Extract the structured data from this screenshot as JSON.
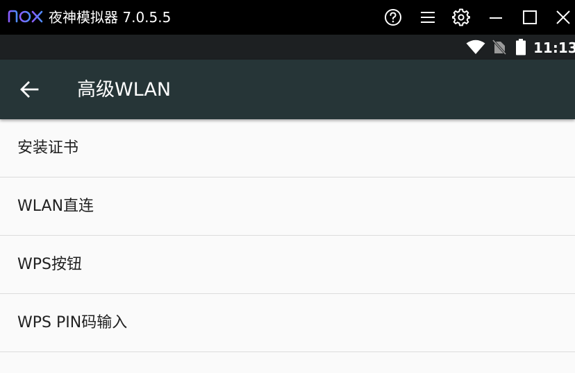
{
  "emulator": {
    "app_title": "夜神模拟器 7.0.5.5",
    "logo_icon": "nox-logo",
    "logo_color": "#7b5cff",
    "controls": [
      "help-icon",
      "menu-icon",
      "settings-icon",
      "minimize-icon",
      "maximize-icon",
      "close-icon"
    ]
  },
  "statusbar": {
    "time": "11:13",
    "icons": [
      "wifi-icon",
      "no-sim-icon",
      "battery-icon"
    ]
  },
  "toolbar": {
    "back_icon": "arrow-back-icon",
    "title": "高级WLAN",
    "background": "#263537"
  },
  "list": {
    "items": [
      {
        "label": "安装证书"
      },
      {
        "label": "WLAN直连"
      },
      {
        "label": "WPS按钮"
      },
      {
        "label": "WPS PIN码输入"
      }
    ]
  }
}
